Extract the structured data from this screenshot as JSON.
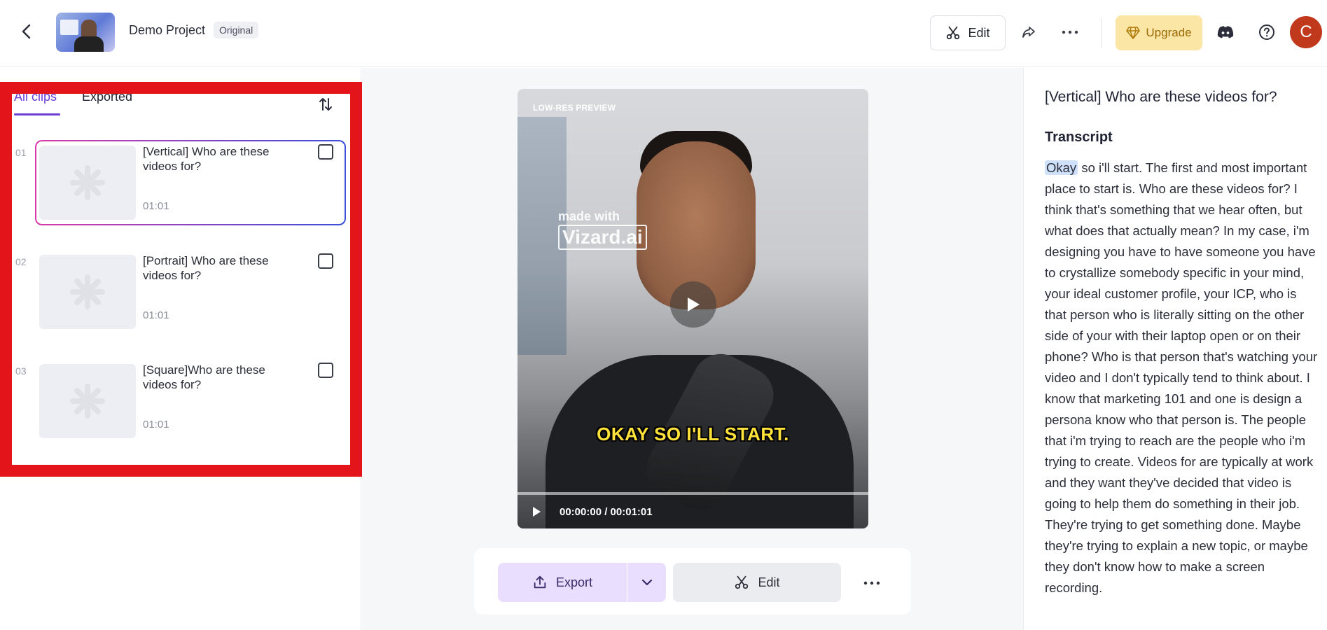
{
  "header": {
    "project_title": "Demo Project",
    "project_badge": "Original",
    "edit_label": "Edit",
    "upgrade_label": "Upgrade",
    "avatar_initial": "C",
    "colors": {
      "upgrade_bg": "#fbe6a6",
      "upgrade_text": "#9a6a06",
      "avatar_bg": "#c0391c"
    }
  },
  "clips_panel": {
    "tabs": [
      {
        "label": "All clips",
        "active": true
      },
      {
        "label": "Exported",
        "active": false
      }
    ],
    "clips": [
      {
        "number": "01",
        "title": "[Vertical] Who are these videos for?",
        "duration": "01:01",
        "selected": true
      },
      {
        "number": "02",
        "title": "[Portrait] Who are these videos for?",
        "duration": "01:01",
        "selected": false
      },
      {
        "number": "03",
        "title": "[Square]Who are these videos for?",
        "duration": "01:01",
        "selected": false
      }
    ],
    "accent_color": "#6b3fd4"
  },
  "player": {
    "preview_label": "LOW-RES PREVIEW",
    "watermark_line1": "made with",
    "watermark_line2": "Vizard.ai",
    "caption": "OKAY SO I'LL START.",
    "timecode": "00:00:00 / 00:01:01"
  },
  "actions": {
    "export_label": "Export",
    "edit_label": "Edit"
  },
  "transcript_panel": {
    "clip_title": "[Vertical] Who are these videos for?",
    "heading": "Transcript",
    "highlighted_word": "Okay",
    "text_after": " so i'll start. The first and most important place to start is. Who are these videos for? I think that's something that we hear often, but what does that actually mean? In my case, i'm designing you have to have someone you have to crystallize somebody specific in your mind, your ideal customer profile, your ICP, who is that person who is literally sitting on the other side of your with their laptop open or on their phone? Who is that person that's watching your video and I don't typically tend to think about. I know that marketing 101 and one is design a persona know who that person is. The people that i'm trying to reach are the people who i'm trying to create. Videos for are typically at work and they want they've decided that video is going to help them do something in their job. They're trying to get something done. Maybe they're trying to explain a new topic, or maybe they don't know how to make a screen recording."
  }
}
